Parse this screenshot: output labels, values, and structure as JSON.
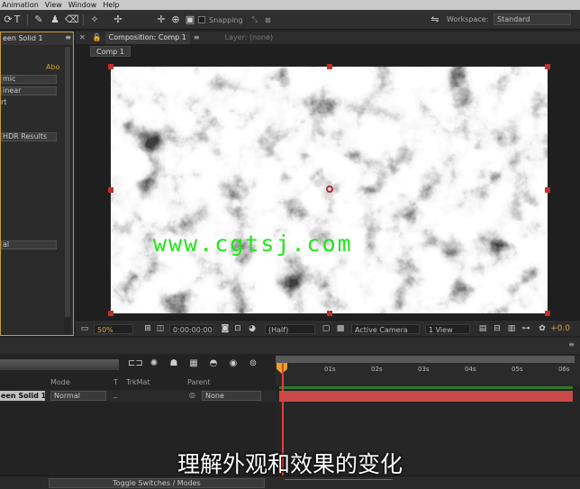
{
  "menubar": {
    "items": [
      "Animation",
      "View",
      "Window",
      "Help"
    ]
  },
  "toolbar": {
    "snapping_label": "Snapping",
    "workspace_label": "Workspace:",
    "workspace_value": "Standard"
  },
  "effect_controls": {
    "tab_label": "een Solid 1",
    "items": [
      {
        "text": "Abo",
        "kind": "label-orange"
      },
      {
        "text": "mic",
        "kind": "dropdown"
      },
      {
        "text": "inear",
        "kind": "dropdown"
      },
      {
        "text": "rt",
        "kind": "label"
      },
      {
        "text": "HDR Results",
        "kind": "dropdown"
      },
      {
        "text": "al",
        "kind": "dropdown"
      }
    ]
  },
  "composition": {
    "tab_label": "Composition: Comp 1",
    "layer_tab_label": "Layer: (none)",
    "subtab_label": "Comp 1",
    "zoom": "50%",
    "timecode": "0:00:00:00",
    "resolution": "(Half)",
    "camera": "Active Camera",
    "view": "1 View",
    "exposure": "+0.0"
  },
  "viewer": {
    "watermark": "www.cgtsj.com",
    "subtitle": "理解外观和效果的变化"
  },
  "timeline": {
    "headers": {
      "mode": "Mode",
      "t": "T",
      "trkmat": "TrkMat",
      "parent": "Parent"
    },
    "layer": {
      "name": "een Solid 1",
      "mode": "Normal",
      "trkmat": "_",
      "parent": "None"
    },
    "ruler_ticks": [
      "0s",
      "01s",
      "02s",
      "03s",
      "04s",
      "05s",
      "06s"
    ],
    "toggle_label": "Toggle Switches / Modes"
  },
  "colors": {
    "accent_orange": "#d39a2a",
    "watermark_green": "#21e61c",
    "layer_bar": "#c84a48",
    "playhead": "#e0403a"
  }
}
